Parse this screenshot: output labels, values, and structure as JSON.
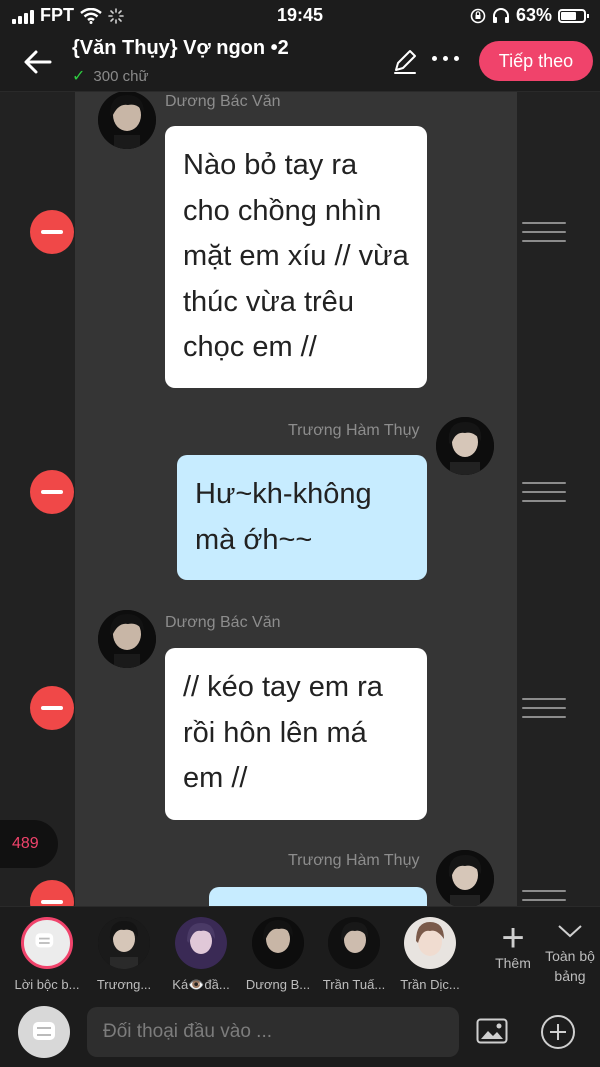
{
  "status": {
    "carrier": "FPT",
    "time": "19:45",
    "battery": "63%"
  },
  "nav": {
    "title": "{Văn Thụy} Vợ ngon •2",
    "word_count": "300 chữ",
    "next_label": "Tiếp theo"
  },
  "messages": [
    {
      "speaker": "Dương Bác Văn",
      "text": "Nào bỏ tay ra cho chồng nhìn mặt em xíu // vừa thúc vừa trêu chọc em //",
      "side": "left",
      "color": "#ffffff"
    },
    {
      "speaker": "Trương Hàm Thụy",
      "text": "Hư~kh-không mà ớh~~",
      "side": "right",
      "color": "#c7ecff"
    },
    {
      "speaker": "Dương Bác Văn",
      "text": "// kéo tay em ra rồi hôn lên má em //",
      "side": "left",
      "color": "#ffffff"
    },
    {
      "speaker": "Trương Hàm Thụy",
      "text": "",
      "side": "right",
      "color": "#c7ecff"
    }
  ],
  "counter": "489",
  "characters": [
    {
      "name": "Lời bộc b...",
      "icon": "narration-icon"
    },
    {
      "name": "Trương..."
    },
    {
      "name": "Ká👁️đầ..."
    },
    {
      "name": "Dương B..."
    },
    {
      "name": "Trần Tuấ..."
    },
    {
      "name": "Trần Dịc..."
    }
  ],
  "char_more": "Thêm",
  "char_all": "Toàn bộ bảng",
  "input": {
    "placeholder": "Đối thoại đầu vào ..."
  },
  "colors": {
    "accent": "#f0436b",
    "delete": "#f04848",
    "bubble_left": "#ffffff",
    "bubble_right": "#c7ecff"
  }
}
